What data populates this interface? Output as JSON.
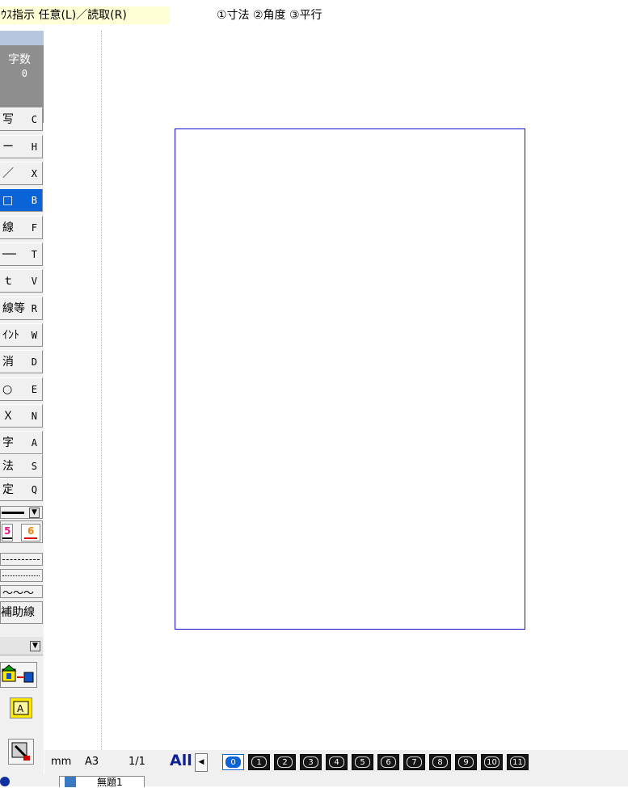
{
  "message_bar": {
    "mouse_hint": "ｳｽ指示 任意(L)／読取(R)",
    "operations": "①寸法 ②角度 ③平行"
  },
  "palette": {
    "count_label": "字数",
    "count_value": "0",
    "tools": [
      {
        "label": "写",
        "key": "C"
      },
      {
        "label": "ー",
        "key": "H"
      },
      {
        "label": "／",
        "key": "X"
      },
      {
        "label": "□",
        "key": "B",
        "active": true
      },
      {
        "label": "線",
        "key": "F"
      },
      {
        "label": "──",
        "key": "T"
      },
      {
        "label": "ｔ",
        "key": "V"
      },
      {
        "label": "線等",
        "key": "R"
      },
      {
        "label": "ｲﾝﾄ",
        "key": "W"
      },
      {
        "label": "消",
        "key": "D"
      },
      {
        "label": "○",
        "key": "E"
      },
      {
        "label": "Ｘ",
        "key": "N"
      },
      {
        "label": "字",
        "key": "A"
      },
      {
        "label": "法",
        "key": "S"
      },
      {
        "label": "定",
        "key": "Q"
      }
    ],
    "color_left": "5",
    "color_right": "6",
    "auxiliary_line": "補助線",
    "colors": {
      "active": "#0a64d8",
      "color5": "#e0188c",
      "color6": "#f08010"
    }
  },
  "canvas": {
    "paper_border_color": "#1010d0"
  },
  "status_bar": {
    "unit": "mm",
    "paper_size": "A3",
    "scale": "1/1",
    "all_label": "All",
    "layers": [
      "0",
      "1",
      "2",
      "3",
      "4",
      "5",
      "6",
      "7",
      "8",
      "9",
      "10",
      "11"
    ]
  },
  "tabs": {
    "document": "無題1"
  }
}
